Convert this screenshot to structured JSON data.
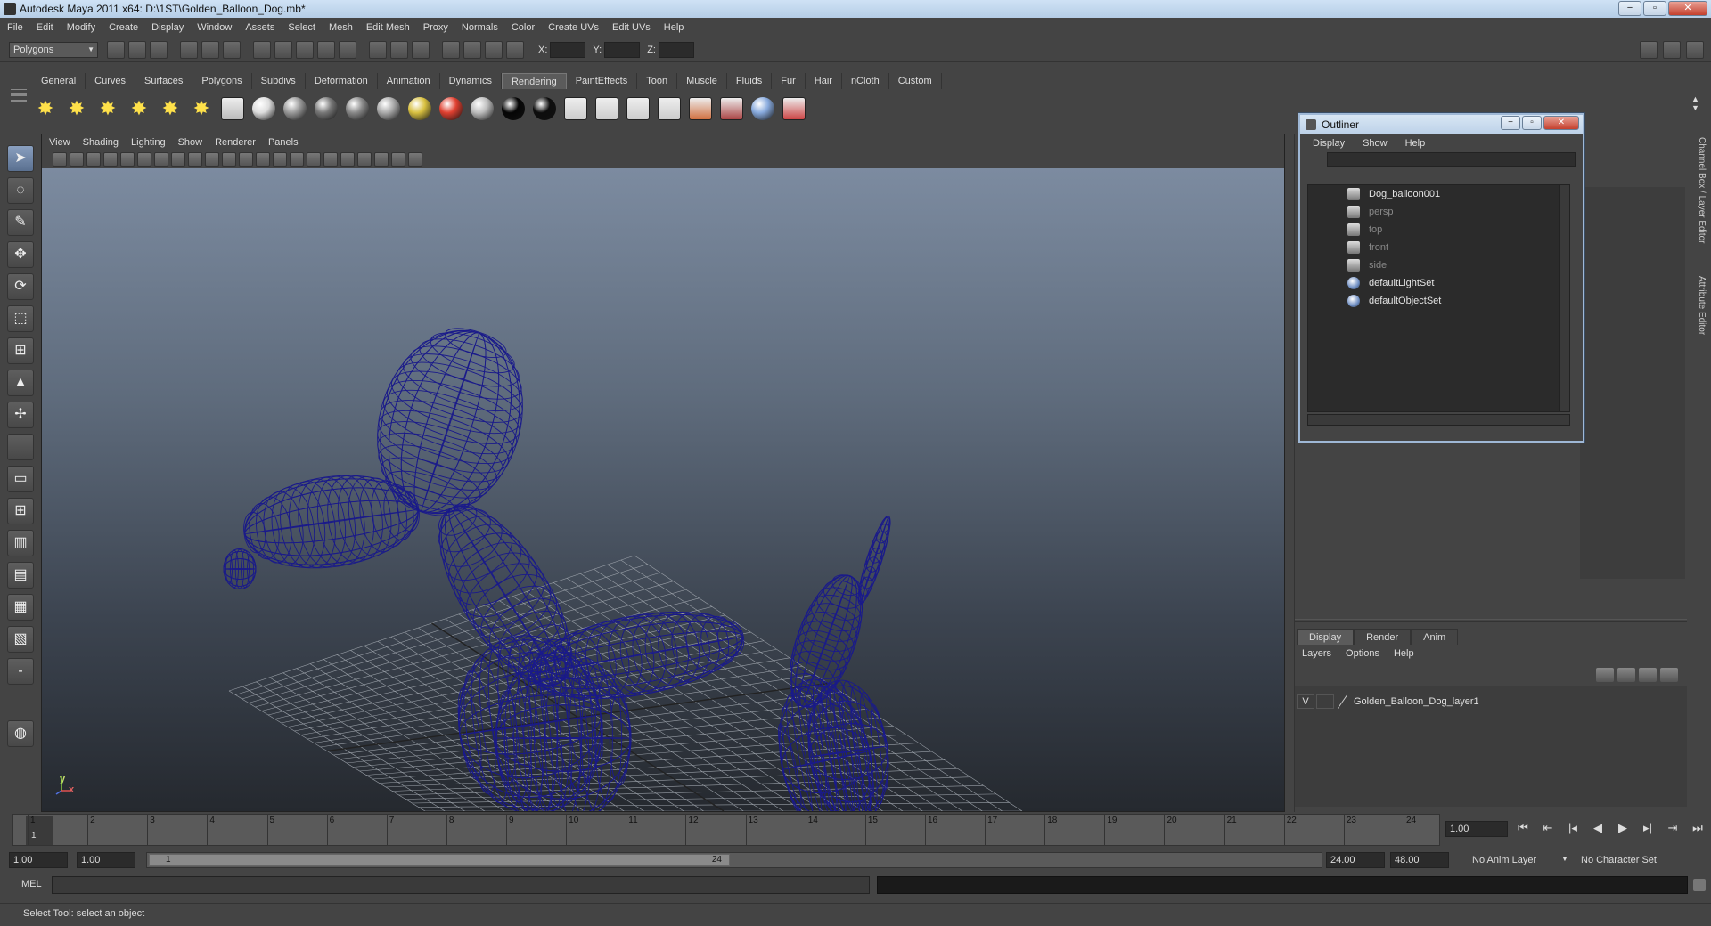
{
  "window": {
    "title": "Autodesk Maya 2011 x64: D:\\1ST\\Golden_Balloon_Dog.mb*",
    "minimize": "−",
    "maximize": "▫",
    "close": "✕"
  },
  "menubar": [
    "File",
    "Edit",
    "Modify",
    "Create",
    "Display",
    "Window",
    "Assets",
    "Select",
    "Mesh",
    "Edit Mesh",
    "Proxy",
    "Normals",
    "Color",
    "Create UVs",
    "Edit UVs",
    "Help"
  ],
  "statusline": {
    "mode": "Polygons",
    "x_label": "X:",
    "y_label": "Y:",
    "z_label": "Z:"
  },
  "shelf": {
    "tabs": [
      "General",
      "Curves",
      "Surfaces",
      "Polygons",
      "Subdivs",
      "Deformation",
      "Animation",
      "Dynamics",
      "Rendering",
      "PaintEffects",
      "Toon",
      "Muscle",
      "Fluids",
      "Fur",
      "Hair",
      "nCloth",
      "Custom"
    ],
    "active_tab": "Rendering"
  },
  "viewport": {
    "menu": [
      "View",
      "Shading",
      "Lighting",
      "Show",
      "Renderer",
      "Panels"
    ],
    "axis_y": "y",
    "axis_x": "x",
    "mesh_color": "#1a1a8a",
    "grid_color": "#9aa0a8"
  },
  "outliner": {
    "title": "Outliner",
    "menu": [
      "Display",
      "Show",
      "Help"
    ],
    "items": [
      {
        "label": "Dog_balloon001",
        "icon": "mesh-transform-icon",
        "dim": false
      },
      {
        "label": "persp",
        "icon": "camera-icon",
        "dim": true
      },
      {
        "label": "top",
        "icon": "camera-icon",
        "dim": true
      },
      {
        "label": "front",
        "icon": "camera-icon",
        "dim": true
      },
      {
        "label": "side",
        "icon": "camera-icon",
        "dim": true
      },
      {
        "label": "defaultLightSet",
        "icon": "set-icon",
        "dim": false
      },
      {
        "label": "defaultObjectSet",
        "icon": "set-icon",
        "dim": false
      }
    ]
  },
  "layers": {
    "tabs": [
      "Display",
      "Render",
      "Anim"
    ],
    "active_tab": "Display",
    "menu": [
      "Layers",
      "Options",
      "Help"
    ],
    "rows": [
      {
        "visible": "V",
        "name": "Golden_Balloon_Dog_layer1"
      }
    ]
  },
  "side_tabs": [
    "Channel Box / Layer Editor",
    "Attribute Editor"
  ],
  "timeslider": {
    "start": 1,
    "end": 24,
    "current": "1",
    "current_time_field": "1.00"
  },
  "range": {
    "start_time": "1.00",
    "playback_start": "1.00",
    "handle_start": "1",
    "handle_end": "24",
    "playback_end": "24.00",
    "end_time": "48.00",
    "anim_layer": "No Anim Layer",
    "character_set": "No Character Set"
  },
  "commandline": {
    "language": "MEL"
  },
  "helpline": {
    "text": "Select Tool: select an object"
  }
}
